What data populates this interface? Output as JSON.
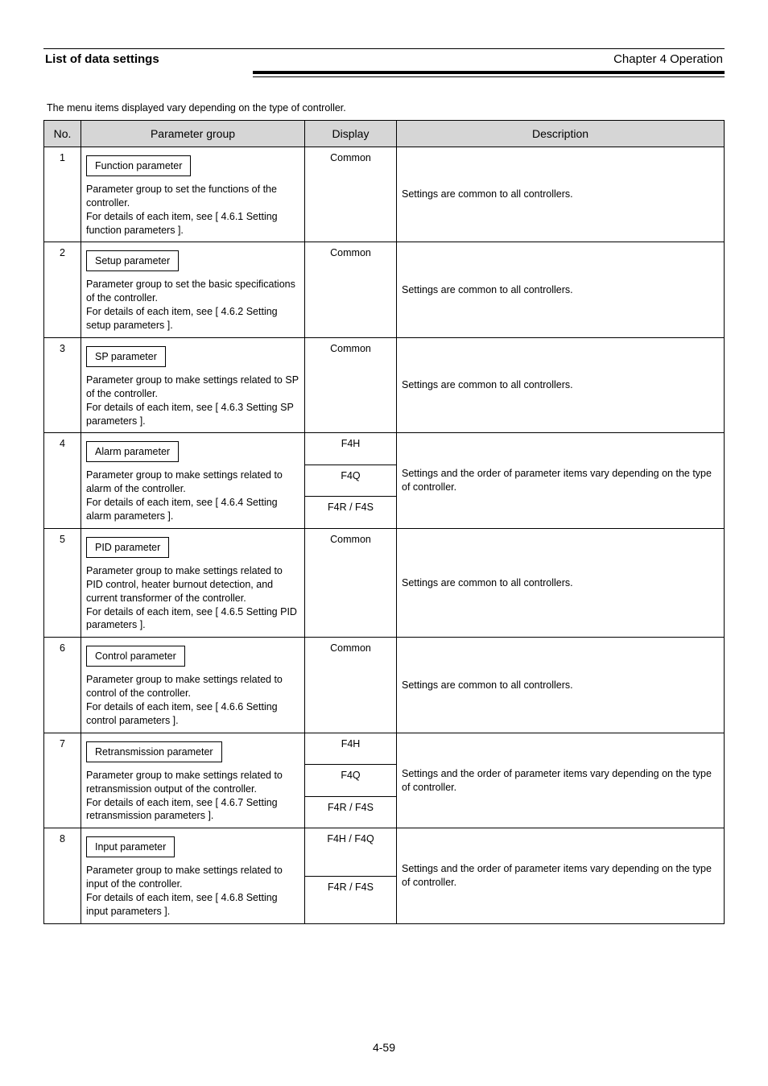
{
  "header": {
    "left_bold": "List of data settings",
    "left_rest": "",
    "right": "Chapter 4 Operation"
  },
  "intro": "The menu items displayed vary depending on the type of controller.",
  "columns": {
    "c1": "No.",
    "c2": "Parameter group",
    "c3": "Display",
    "c4": "Description"
  },
  "rows": [
    {
      "num": "1",
      "btn": "Function parameter",
      "line1": "Parameter group to set the functions of the controller.",
      "line2": "For details of each item, see [ 4.6.1 Setting function parameters ].",
      "opts": [
        "Common"
      ],
      "desc": "Settings are common to all controllers."
    },
    {
      "num": "2",
      "btn": "Setup parameter",
      "line1": "Parameter group to set the basic specifications of the controller.",
      "line2": "For details of each item, see [ 4.6.2 Setting setup parameters ].",
      "opts": [
        "Common"
      ],
      "desc": "Settings are common to all controllers."
    },
    {
      "num": "3",
      "btn": "SP parameter",
      "line1": "Parameter group to make settings related to SP of the controller.",
      "line2": "For details of each item, see [ 4.6.3 Setting SP parameters ].",
      "opts": [
        "Common"
      ],
      "desc": "Settings are common to all controllers."
    },
    {
      "num": "4",
      "btn": "Alarm parameter",
      "line1": "Parameter group to make settings related to alarm of the controller.",
      "line2": "For details of each item, see [ 4.6.4 Setting alarm parameters ].",
      "opts": [
        "F4H",
        "F4Q",
        "F4R / F4S"
      ],
      "desc": "Settings and the order of parameter items vary depending on the type of controller."
    },
    {
      "num": "5",
      "btn": "PID parameter",
      "line1": "Parameter group to make settings related to PID control, heater burnout detection, and current transformer of the controller.",
      "line2": "For details of each item, see [ 4.6.5 Setting PID parameters ].",
      "opts": [
        "Common"
      ],
      "desc": "Settings are common to all controllers."
    },
    {
      "num": "6",
      "btn": "Control parameter",
      "line1": "Parameter group to make settings related to control of the controller.",
      "line2": "For details of each item, see [ 4.6.6 Setting control parameters ].",
      "opts": [
        "Common"
      ],
      "desc": "Settings are common to all controllers."
    },
    {
      "num": "7",
      "btn": "Retransmission parameter",
      "line1": "Parameter group to make settings related to retransmission output of the controller.",
      "line2": "For details of each item, see [ 4.6.7 Setting retransmission parameters ].",
      "opts": [
        "F4H",
        "F4Q",
        "F4R / F4S"
      ],
      "desc": "Settings and the order of parameter items vary depending on the type of controller."
    },
    {
      "num": "8",
      "btn": "Input parameter",
      "line1": "Parameter group to make settings related to input of the controller.",
      "line2": "For details of each item, see [ 4.6.8 Setting input parameters ].",
      "opts": [
        "F4H / F4Q",
        "F4R / F4S"
      ],
      "desc": "Settings and the order of parameter items vary depending on the type of controller."
    }
  ],
  "page_number": "4-59"
}
